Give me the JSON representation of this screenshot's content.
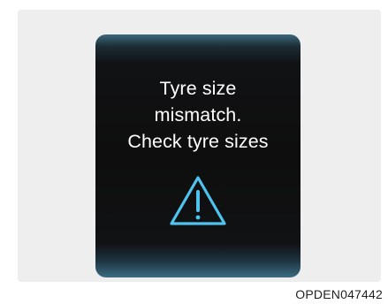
{
  "display": {
    "message_lines": [
      "Tyre size",
      "mismatch.",
      "Check tyre sizes"
    ],
    "icon": "warning-triangle-icon",
    "icon_color": "#4ec3ee",
    "text_color": "#ffffff",
    "screen_color": "#0e0e0e",
    "edge_glow_color": "#3b6d82"
  },
  "caption": {
    "code": "OPDEN047442"
  }
}
